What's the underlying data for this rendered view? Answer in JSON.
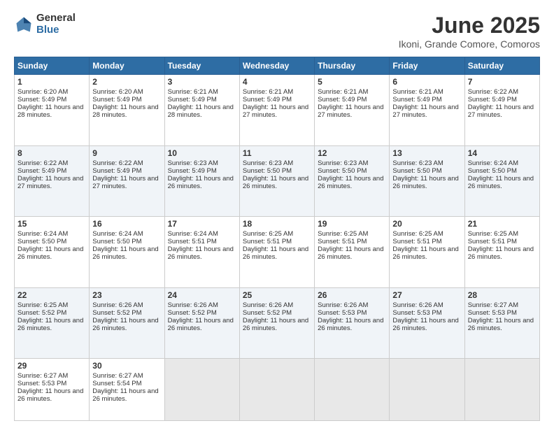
{
  "logo": {
    "general": "General",
    "blue": "Blue"
  },
  "title": "June 2025",
  "subtitle": "Ikoni, Grande Comore, Comoros",
  "days": [
    "Sunday",
    "Monday",
    "Tuesday",
    "Wednesday",
    "Thursday",
    "Friday",
    "Saturday"
  ],
  "weeks": [
    [
      {
        "num": "1",
        "rise": "6:20 AM",
        "set": "5:49 PM",
        "daylight": "11 hours and 28 minutes."
      },
      {
        "num": "2",
        "rise": "6:20 AM",
        "set": "5:49 PM",
        "daylight": "11 hours and 28 minutes."
      },
      {
        "num": "3",
        "rise": "6:21 AM",
        "set": "5:49 PM",
        "daylight": "11 hours and 28 minutes."
      },
      {
        "num": "4",
        "rise": "6:21 AM",
        "set": "5:49 PM",
        "daylight": "11 hours and 27 minutes."
      },
      {
        "num": "5",
        "rise": "6:21 AM",
        "set": "5:49 PM",
        "daylight": "11 hours and 27 minutes."
      },
      {
        "num": "6",
        "rise": "6:21 AM",
        "set": "5:49 PM",
        "daylight": "11 hours and 27 minutes."
      },
      {
        "num": "7",
        "rise": "6:22 AM",
        "set": "5:49 PM",
        "daylight": "11 hours and 27 minutes."
      }
    ],
    [
      {
        "num": "8",
        "rise": "6:22 AM",
        "set": "5:49 PM",
        "daylight": "11 hours and 27 minutes."
      },
      {
        "num": "9",
        "rise": "6:22 AM",
        "set": "5:49 PM",
        "daylight": "11 hours and 27 minutes."
      },
      {
        "num": "10",
        "rise": "6:23 AM",
        "set": "5:49 PM",
        "daylight": "11 hours and 26 minutes."
      },
      {
        "num": "11",
        "rise": "6:23 AM",
        "set": "5:50 PM",
        "daylight": "11 hours and 26 minutes."
      },
      {
        "num": "12",
        "rise": "6:23 AM",
        "set": "5:50 PM",
        "daylight": "11 hours and 26 minutes."
      },
      {
        "num": "13",
        "rise": "6:23 AM",
        "set": "5:50 PM",
        "daylight": "11 hours and 26 minutes."
      },
      {
        "num": "14",
        "rise": "6:24 AM",
        "set": "5:50 PM",
        "daylight": "11 hours and 26 minutes."
      }
    ],
    [
      {
        "num": "15",
        "rise": "6:24 AM",
        "set": "5:50 PM",
        "daylight": "11 hours and 26 minutes."
      },
      {
        "num": "16",
        "rise": "6:24 AM",
        "set": "5:50 PM",
        "daylight": "11 hours and 26 minutes."
      },
      {
        "num": "17",
        "rise": "6:24 AM",
        "set": "5:51 PM",
        "daylight": "11 hours and 26 minutes."
      },
      {
        "num": "18",
        "rise": "6:25 AM",
        "set": "5:51 PM",
        "daylight": "11 hours and 26 minutes."
      },
      {
        "num": "19",
        "rise": "6:25 AM",
        "set": "5:51 PM",
        "daylight": "11 hours and 26 minutes."
      },
      {
        "num": "20",
        "rise": "6:25 AM",
        "set": "5:51 PM",
        "daylight": "11 hours and 26 minutes."
      },
      {
        "num": "21",
        "rise": "6:25 AM",
        "set": "5:51 PM",
        "daylight": "11 hours and 26 minutes."
      }
    ],
    [
      {
        "num": "22",
        "rise": "6:25 AM",
        "set": "5:52 PM",
        "daylight": "11 hours and 26 minutes."
      },
      {
        "num": "23",
        "rise": "6:26 AM",
        "set": "5:52 PM",
        "daylight": "11 hours and 26 minutes."
      },
      {
        "num": "24",
        "rise": "6:26 AM",
        "set": "5:52 PM",
        "daylight": "11 hours and 26 minutes."
      },
      {
        "num": "25",
        "rise": "6:26 AM",
        "set": "5:52 PM",
        "daylight": "11 hours and 26 minutes."
      },
      {
        "num": "26",
        "rise": "6:26 AM",
        "set": "5:53 PM",
        "daylight": "11 hours and 26 minutes."
      },
      {
        "num": "27",
        "rise": "6:26 AM",
        "set": "5:53 PM",
        "daylight": "11 hours and 26 minutes."
      },
      {
        "num": "28",
        "rise": "6:27 AM",
        "set": "5:53 PM",
        "daylight": "11 hours and 26 minutes."
      }
    ],
    [
      {
        "num": "29",
        "rise": "6:27 AM",
        "set": "5:53 PM",
        "daylight": "11 hours and 26 minutes."
      },
      {
        "num": "30",
        "rise": "6:27 AM",
        "set": "5:54 PM",
        "daylight": "11 hours and 26 minutes."
      },
      null,
      null,
      null,
      null,
      null
    ]
  ]
}
